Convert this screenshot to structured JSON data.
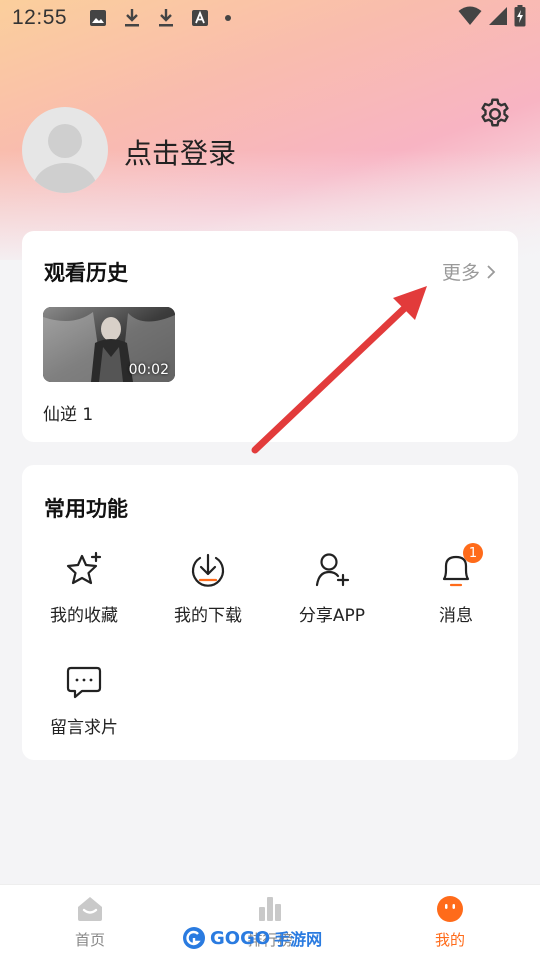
{
  "status_bar": {
    "time": "12:55",
    "icons": [
      "image-icon",
      "download-icon",
      "download-icon",
      "a-icon",
      "dot-icon"
    ],
    "right_icons": [
      "wifi-icon",
      "signal-icon",
      "battery-charging-icon"
    ]
  },
  "profile": {
    "login_text": "点击登录",
    "settings_icon": "gear-icon"
  },
  "history": {
    "title": "观看历史",
    "more_label": "更多",
    "items": [
      {
        "title": "仙逆 1",
        "duration": "00:02"
      }
    ]
  },
  "functions": {
    "title": "常用功能",
    "items": [
      {
        "label": "我的收藏",
        "icon": "star-plus-icon"
      },
      {
        "label": "我的下载",
        "icon": "download-circle-icon"
      },
      {
        "label": "分享APP",
        "icon": "user-add-icon"
      },
      {
        "label": "消息",
        "icon": "bell-icon",
        "badge": "1"
      },
      {
        "label": "留言求片",
        "icon": "message-icon"
      }
    ]
  },
  "bottom_nav": {
    "items": [
      {
        "label": "首页",
        "icon": "home-icon",
        "active": false
      },
      {
        "label": "排行榜",
        "icon": "chart-icon",
        "active": false
      },
      {
        "label": "我的",
        "icon": "face-icon",
        "active": true
      }
    ]
  },
  "watermark": {
    "brand": "GOGO",
    "text": "手游网"
  },
  "colors": {
    "accent": "#ff6b1a",
    "annotation_arrow": "#e23b3b"
  }
}
